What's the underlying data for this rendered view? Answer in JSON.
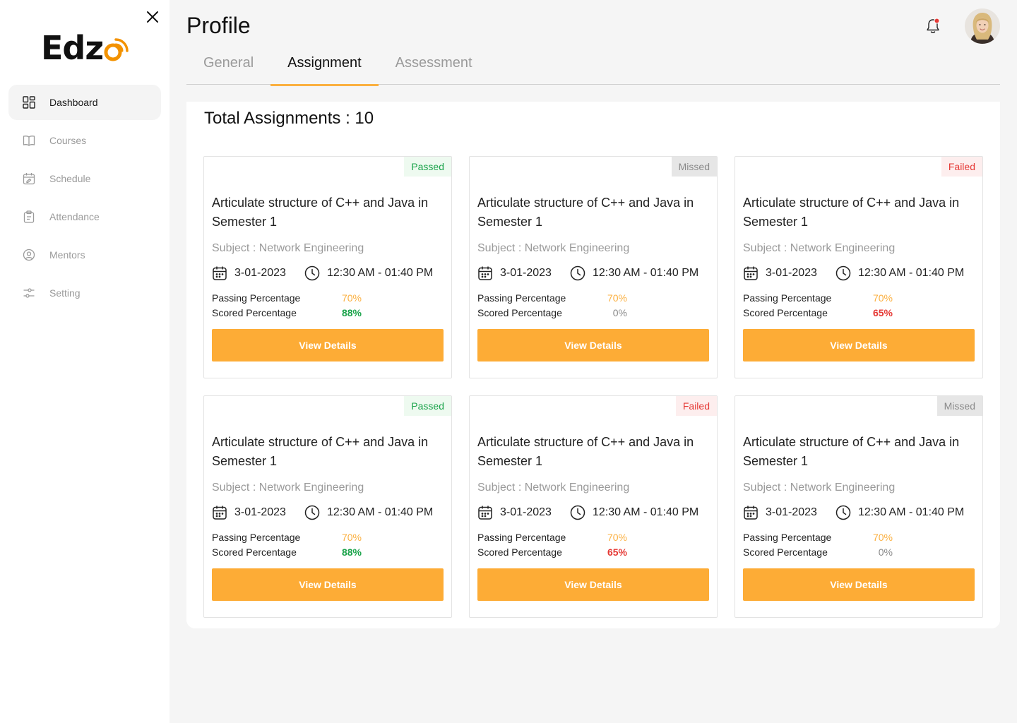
{
  "sidebar": {
    "brand": "Edz",
    "items": [
      {
        "label": "Dashboard",
        "icon": "dashboard-icon",
        "active": true
      },
      {
        "label": "Courses",
        "icon": "book-icon"
      },
      {
        "label": "Schedule",
        "icon": "calendar-edit-icon"
      },
      {
        "label": "Attendance",
        "icon": "clipboard-icon"
      },
      {
        "label": "Mentors",
        "icon": "mentor-icon"
      },
      {
        "label": "Setting",
        "icon": "sliders-icon"
      }
    ]
  },
  "header": {
    "title": "Profile"
  },
  "tabs": [
    {
      "label": "General"
    },
    {
      "label": "Assignment",
      "active": true
    },
    {
      "label": "Assessment"
    }
  ],
  "main": {
    "total": "Total Assignments : 10",
    "cards": [
      {
        "status": "Passed",
        "title": "Articulate structure of C++ and Java in Semester 1",
        "subject": "Subject : Network Engineering",
        "date": "3-01-2023",
        "time": "12:30 AM - 01:40 PM",
        "passing_label": "Passing Percentage",
        "passing": "70%",
        "scored_label": "Scored Percentage",
        "scored": "88%",
        "button": "View Details"
      },
      {
        "status": "Missed",
        "title": "Articulate structure of C++ and Java in Semester 1",
        "subject": "Subject : Network Engineering",
        "date": "3-01-2023",
        "time": "12:30 AM - 01:40 PM",
        "passing_label": "Passing Percentage",
        "passing": "70%",
        "scored_label": "Scored Percentage",
        "scored": "0%",
        "button": "View Details"
      },
      {
        "status": "Failed",
        "title": "Articulate structure of C++ and Java in Semester 1",
        "subject": "Subject : Network Engineering",
        "date": "3-01-2023",
        "time": "12:30 AM - 01:40 PM",
        "passing_label": "Passing Percentage",
        "passing": "70%",
        "scored_label": "Scored Percentage",
        "scored": "65%",
        "button": "View Details"
      },
      {
        "status": "Passed",
        "title": "Articulate structure of C++ and Java in Semester 1",
        "subject": "Subject : Network Engineering",
        "date": "3-01-2023",
        "time": "12:30 AM - 01:40 PM",
        "passing_label": "Passing Percentage",
        "passing": "70%",
        "scored_label": "Scored Percentage",
        "scored": "88%",
        "button": "View Details"
      },
      {
        "status": "Failed",
        "title": "Articulate structure of C++ and Java in Semester 1",
        "subject": "Subject : Network Engineering",
        "date": "3-01-2023",
        "time": "12:30 AM - 01:40 PM",
        "passing_label": "Passing Percentage",
        "passing": "70%",
        "scored_label": "Scored Percentage",
        "scored": "65%",
        "button": "View Details"
      },
      {
        "status": "Missed",
        "title": "Articulate structure of C++ and Java in Semester 1",
        "subject": "Subject : Network Engineering",
        "date": "3-01-2023",
        "time": "12:30 AM - 01:40 PM",
        "passing_label": "Passing Percentage",
        "passing": "70%",
        "scored_label": "Scored Percentage",
        "scored": "0%",
        "button": "View Details"
      }
    ]
  },
  "colors": {
    "accent": "#fdac36",
    "passed": "#1aa34a",
    "failed": "#e53935",
    "missed": "#8a8a8a",
    "notification_dot": "#e53935"
  }
}
